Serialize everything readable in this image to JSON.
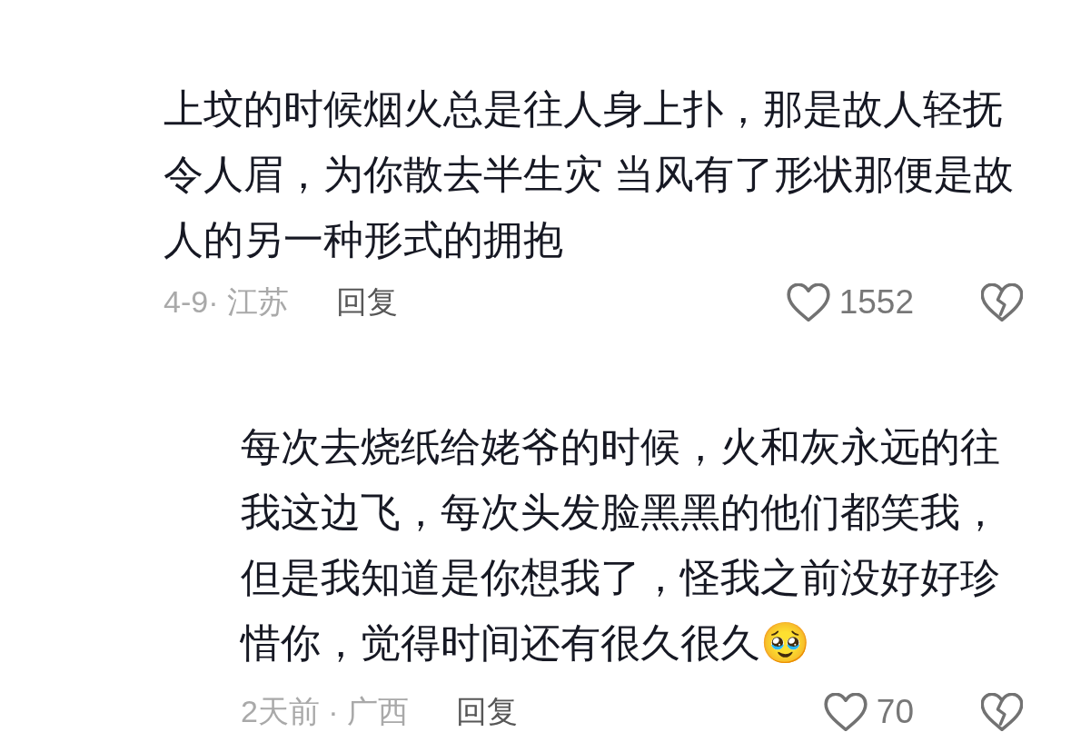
{
  "comments": [
    {
      "text": "上坟的时候烟火总是往人身上扑，那是故人轻抚令人眉，为你散去半生灾 当风有了形状那便是故人的另一种形式的拥抱",
      "time_location": "4-9· 江苏",
      "reply_label": "回复",
      "likes": "1552",
      "liked": false,
      "disliked": false,
      "replies": [
        {
          "text": "每次去烧纸给姥爷的时候，火和灰永远的往我这边飞，每次头发脸黑黑的他们都笑我，但是我知道是你想我了，怪我之前没好好珍惜你，觉得时间还有很久很久🥹",
          "time_location": "2天前 · 广西",
          "reply_label": "回复",
          "likes": "70",
          "liked": false,
          "disliked": false
        }
      ]
    }
  ]
}
